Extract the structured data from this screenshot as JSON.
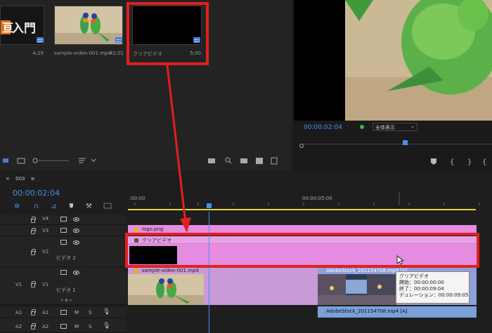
{
  "project": {
    "clips": [
      {
        "name": "",
        "duration": "4;29",
        "logo_text": "入門"
      },
      {
        "name": "sample-video-001.mp4",
        "duration": "42;01"
      },
      {
        "name": "クリアビデオ",
        "duration": "5;00"
      }
    ]
  },
  "program": {
    "timecode": "00:00:02:04",
    "zoom_select": "全体表示"
  },
  "timeline": {
    "sequence_tab": "003",
    "timecode": "00:00:02:04",
    "ruler": {
      "start": ":00:00",
      "mid": "00:00:05:00"
    },
    "tracks": {
      "v4": {
        "label": "V4"
      },
      "v3": {
        "label": "V3"
      },
      "v2": {
        "label": "V2",
        "name": "ビデオ 2"
      },
      "v1": {
        "src": "V1",
        "label": "V1",
        "name": "ビデオ 1"
      },
      "a1": {
        "src": "A1",
        "label": "A1",
        "m": "M",
        "s": "S"
      },
      "a2": {
        "src": "A2",
        "label": "A2",
        "m": "M",
        "s": "S"
      }
    },
    "clips": {
      "logo": "logo.png",
      "clear_video": "クリアビデオ",
      "sample": "sample-video-001.mp4",
      "adobestock_v": "AdobeStock_201154708.mp4 [V]",
      "adobestock_a": "AdobeStock_201154708.mp4 [A]"
    },
    "tooltip": {
      "title": "クリアビデオ",
      "start": "開始：00:00:00:00",
      "end": "終了：00:00:09:04",
      "duration": "デュレーション：00:00:09:05"
    }
  },
  "colors": {
    "accent_blue": "#4a7bd8",
    "highlight_red": "#e21f1f",
    "clip_pink": "#e58ce0",
    "clip_purple": "#c99ad8"
  }
}
